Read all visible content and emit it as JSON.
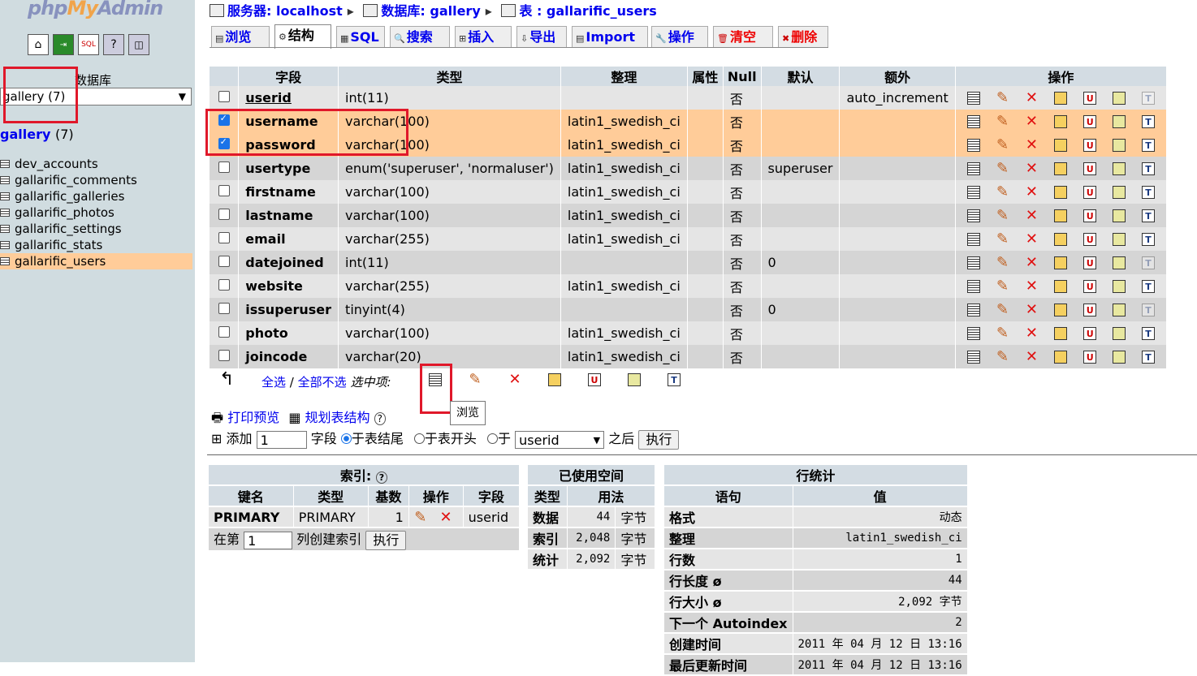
{
  "nav": {
    "logo_php": "php",
    "logo_my": "My",
    "logo_admin": "Admin",
    "db_label": "数据库",
    "db_select_value": "gallery (7)",
    "db_link": "gallery",
    "db_link_count": "(7)",
    "tables": [
      "dev_accounts",
      "gallarific_comments",
      "gallarific_galleries",
      "gallarific_photos",
      "gallarific_settings",
      "gallarific_stats",
      "gallarific_users"
    ],
    "selected_table": "gallarific_users"
  },
  "breadcrumb": {
    "server": "服务器: localhost",
    "database": "数据库: gallery",
    "table": "表 : gallarific_users"
  },
  "tabs": [
    "浏览",
    "结构",
    "SQL",
    "搜索",
    "插入",
    "导出",
    "Import",
    "操作",
    "清空",
    "删除"
  ],
  "active_tab": "结构",
  "fields_table": {
    "headers": [
      "字段",
      "类型",
      "整理",
      "属性",
      "Null",
      "默认",
      "额外",
      "操作"
    ],
    "rows": [
      {
        "name": "userid",
        "type": "int(11)",
        "collation": "",
        "attr": "",
        "null": "否",
        "default": "",
        "extra": "auto_increment",
        "checked": false,
        "primary": true
      },
      {
        "name": "username",
        "type": "varchar(100)",
        "collation": "latin1_swedish_ci",
        "attr": "",
        "null": "否",
        "default": "",
        "extra": "",
        "checked": true
      },
      {
        "name": "password",
        "type": "varchar(100)",
        "collation": "latin1_swedish_ci",
        "attr": "",
        "null": "否",
        "default": "",
        "extra": "",
        "checked": true
      },
      {
        "name": "usertype",
        "type": "enum('superuser', 'normaluser')",
        "collation": "latin1_swedish_ci",
        "attr": "",
        "null": "否",
        "default": "superuser",
        "extra": "",
        "checked": false
      },
      {
        "name": "firstname",
        "type": "varchar(100)",
        "collation": "latin1_swedish_ci",
        "attr": "",
        "null": "否",
        "default": "",
        "extra": "",
        "checked": false
      },
      {
        "name": "lastname",
        "type": "varchar(100)",
        "collation": "latin1_swedish_ci",
        "attr": "",
        "null": "否",
        "default": "",
        "extra": "",
        "checked": false
      },
      {
        "name": "email",
        "type": "varchar(255)",
        "collation": "latin1_swedish_ci",
        "attr": "",
        "null": "否",
        "default": "",
        "extra": "",
        "checked": false
      },
      {
        "name": "datejoined",
        "type": "int(11)",
        "collation": "",
        "attr": "",
        "null": "否",
        "default": "0",
        "extra": "",
        "checked": false
      },
      {
        "name": "website",
        "type": "varchar(255)",
        "collation": "latin1_swedish_ci",
        "attr": "",
        "null": "否",
        "default": "",
        "extra": "",
        "checked": false
      },
      {
        "name": "issuperuser",
        "type": "tinyint(4)",
        "collation": "",
        "attr": "",
        "null": "否",
        "default": "0",
        "extra": "",
        "checked": false
      },
      {
        "name": "photo",
        "type": "varchar(100)",
        "collation": "latin1_swedish_ci",
        "attr": "",
        "null": "否",
        "default": "",
        "extra": "",
        "checked": false
      },
      {
        "name": "joincode",
        "type": "varchar(20)",
        "collation": "latin1_swedish_ci",
        "attr": "",
        "null": "否",
        "default": "",
        "extra": "",
        "checked": false
      }
    ]
  },
  "selection": {
    "check_all": "全选",
    "separator": "/",
    "uncheck_all": "全部不选",
    "with_selected": "选中项:",
    "tooltip": "浏览"
  },
  "actions": {
    "print_preview": "打印预览",
    "propose_structure": "规划表结构",
    "add_label": "添加",
    "add_count": "1",
    "fields_label": "字段",
    "at_end": "于表结尾",
    "at_beginning": "于表开头",
    "after_label": "于",
    "after_field": "userid",
    "after_suffix": "之后",
    "go": "执行"
  },
  "indexes": {
    "title": "索引:",
    "headers": [
      "键名",
      "类型",
      "基数",
      "操作",
      "字段"
    ],
    "rows": [
      {
        "key": "PRIMARY",
        "type": "PRIMARY",
        "cardinality": "1",
        "field": "userid"
      }
    ],
    "create_prefix": "在第",
    "create_value": "1",
    "create_suffix": "列创建索引",
    "go": "执行"
  },
  "space": {
    "title": "已使用空间",
    "headers": [
      "类型",
      "用法"
    ],
    "rows": [
      {
        "type": "数据",
        "value": "44",
        "unit": "字节"
      },
      {
        "type": "索引",
        "value": "2,048",
        "unit": "字节"
      },
      {
        "type": "统计",
        "value": "2,092",
        "unit": "字节"
      }
    ]
  },
  "rowstats": {
    "title": "行统计",
    "headers": [
      "语句",
      "值"
    ],
    "rows": [
      {
        "label": "格式",
        "value": "动态"
      },
      {
        "label": "整理",
        "value": "latin1_swedish_ci"
      },
      {
        "label": "行数",
        "value": "1"
      },
      {
        "label": "行长度 ø",
        "value": "44"
      },
      {
        "label": "行大小 ø",
        "value": "2,092 字节"
      },
      {
        "label": "下一个 Autoindex",
        "value": "2"
      },
      {
        "label": "创建时间",
        "value": "2011 年 04 月 12 日 13:16"
      },
      {
        "label": "最后更新时间",
        "value": "2011 年 04 月 12 日 13:16"
      }
    ]
  },
  "colors": {
    "marked": "#ffcc99",
    "header": "#d3dce3",
    "left_bg": "#d0dce0",
    "annotation": "#e0182a"
  }
}
